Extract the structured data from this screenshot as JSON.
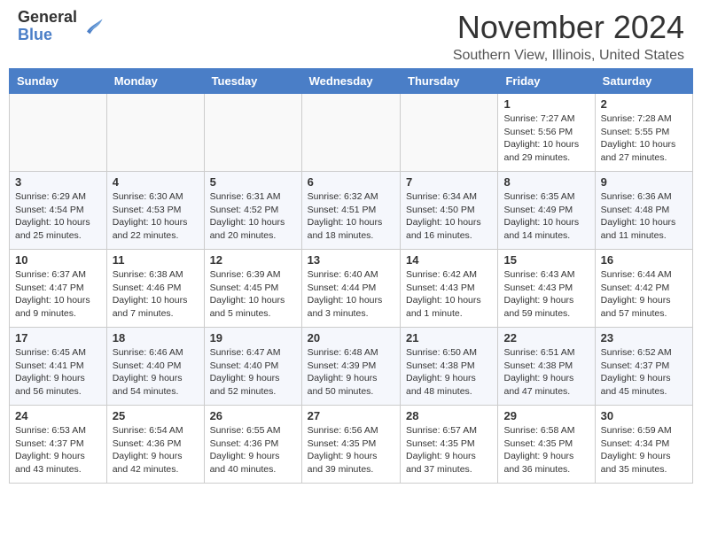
{
  "header": {
    "logo_general": "General",
    "logo_blue": "Blue",
    "month_title": "November 2024",
    "location": "Southern View, Illinois, United States"
  },
  "weekdays": [
    "Sunday",
    "Monday",
    "Tuesday",
    "Wednesday",
    "Thursday",
    "Friday",
    "Saturday"
  ],
  "weeks": [
    [
      {
        "day": "",
        "empty": true
      },
      {
        "day": "",
        "empty": true
      },
      {
        "day": "",
        "empty": true
      },
      {
        "day": "",
        "empty": true
      },
      {
        "day": "",
        "empty": true
      },
      {
        "day": "1",
        "sunrise": "Sunrise: 7:27 AM",
        "sunset": "Sunset: 5:56 PM",
        "daylight": "Daylight: 10 hours and 29 minutes."
      },
      {
        "day": "2",
        "sunrise": "Sunrise: 7:28 AM",
        "sunset": "Sunset: 5:55 PM",
        "daylight": "Daylight: 10 hours and 27 minutes."
      }
    ],
    [
      {
        "day": "3",
        "sunrise": "Sunrise: 6:29 AM",
        "sunset": "Sunset: 4:54 PM",
        "daylight": "Daylight: 10 hours and 25 minutes."
      },
      {
        "day": "4",
        "sunrise": "Sunrise: 6:30 AM",
        "sunset": "Sunset: 4:53 PM",
        "daylight": "Daylight: 10 hours and 22 minutes."
      },
      {
        "day": "5",
        "sunrise": "Sunrise: 6:31 AM",
        "sunset": "Sunset: 4:52 PM",
        "daylight": "Daylight: 10 hours and 20 minutes."
      },
      {
        "day": "6",
        "sunrise": "Sunrise: 6:32 AM",
        "sunset": "Sunset: 4:51 PM",
        "daylight": "Daylight: 10 hours and 18 minutes."
      },
      {
        "day": "7",
        "sunrise": "Sunrise: 6:34 AM",
        "sunset": "Sunset: 4:50 PM",
        "daylight": "Daylight: 10 hours and 16 minutes."
      },
      {
        "day": "8",
        "sunrise": "Sunrise: 6:35 AM",
        "sunset": "Sunset: 4:49 PM",
        "daylight": "Daylight: 10 hours and 14 minutes."
      },
      {
        "day": "9",
        "sunrise": "Sunrise: 6:36 AM",
        "sunset": "Sunset: 4:48 PM",
        "daylight": "Daylight: 10 hours and 11 minutes."
      }
    ],
    [
      {
        "day": "10",
        "sunrise": "Sunrise: 6:37 AM",
        "sunset": "Sunset: 4:47 PM",
        "daylight": "Daylight: 10 hours and 9 minutes."
      },
      {
        "day": "11",
        "sunrise": "Sunrise: 6:38 AM",
        "sunset": "Sunset: 4:46 PM",
        "daylight": "Daylight: 10 hours and 7 minutes."
      },
      {
        "day": "12",
        "sunrise": "Sunrise: 6:39 AM",
        "sunset": "Sunset: 4:45 PM",
        "daylight": "Daylight: 10 hours and 5 minutes."
      },
      {
        "day": "13",
        "sunrise": "Sunrise: 6:40 AM",
        "sunset": "Sunset: 4:44 PM",
        "daylight": "Daylight: 10 hours and 3 minutes."
      },
      {
        "day": "14",
        "sunrise": "Sunrise: 6:42 AM",
        "sunset": "Sunset: 4:43 PM",
        "daylight": "Daylight: 10 hours and 1 minute."
      },
      {
        "day": "15",
        "sunrise": "Sunrise: 6:43 AM",
        "sunset": "Sunset: 4:43 PM",
        "daylight": "Daylight: 9 hours and 59 minutes."
      },
      {
        "day": "16",
        "sunrise": "Sunrise: 6:44 AM",
        "sunset": "Sunset: 4:42 PM",
        "daylight": "Daylight: 9 hours and 57 minutes."
      }
    ],
    [
      {
        "day": "17",
        "sunrise": "Sunrise: 6:45 AM",
        "sunset": "Sunset: 4:41 PM",
        "daylight": "Daylight: 9 hours and 56 minutes."
      },
      {
        "day": "18",
        "sunrise": "Sunrise: 6:46 AM",
        "sunset": "Sunset: 4:40 PM",
        "daylight": "Daylight: 9 hours and 54 minutes."
      },
      {
        "day": "19",
        "sunrise": "Sunrise: 6:47 AM",
        "sunset": "Sunset: 4:40 PM",
        "daylight": "Daylight: 9 hours and 52 minutes."
      },
      {
        "day": "20",
        "sunrise": "Sunrise: 6:48 AM",
        "sunset": "Sunset: 4:39 PM",
        "daylight": "Daylight: 9 hours and 50 minutes."
      },
      {
        "day": "21",
        "sunrise": "Sunrise: 6:50 AM",
        "sunset": "Sunset: 4:38 PM",
        "daylight": "Daylight: 9 hours and 48 minutes."
      },
      {
        "day": "22",
        "sunrise": "Sunrise: 6:51 AM",
        "sunset": "Sunset: 4:38 PM",
        "daylight": "Daylight: 9 hours and 47 minutes."
      },
      {
        "day": "23",
        "sunrise": "Sunrise: 6:52 AM",
        "sunset": "Sunset: 4:37 PM",
        "daylight": "Daylight: 9 hours and 45 minutes."
      }
    ],
    [
      {
        "day": "24",
        "sunrise": "Sunrise: 6:53 AM",
        "sunset": "Sunset: 4:37 PM",
        "daylight": "Daylight: 9 hours and 43 minutes."
      },
      {
        "day": "25",
        "sunrise": "Sunrise: 6:54 AM",
        "sunset": "Sunset: 4:36 PM",
        "daylight": "Daylight: 9 hours and 42 minutes."
      },
      {
        "day": "26",
        "sunrise": "Sunrise: 6:55 AM",
        "sunset": "Sunset: 4:36 PM",
        "daylight": "Daylight: 9 hours and 40 minutes."
      },
      {
        "day": "27",
        "sunrise": "Sunrise: 6:56 AM",
        "sunset": "Sunset: 4:35 PM",
        "daylight": "Daylight: 9 hours and 39 minutes."
      },
      {
        "day": "28",
        "sunrise": "Sunrise: 6:57 AM",
        "sunset": "Sunset: 4:35 PM",
        "daylight": "Daylight: 9 hours and 37 minutes."
      },
      {
        "day": "29",
        "sunrise": "Sunrise: 6:58 AM",
        "sunset": "Sunset: 4:35 PM",
        "daylight": "Daylight: 9 hours and 36 minutes."
      },
      {
        "day": "30",
        "sunrise": "Sunrise: 6:59 AM",
        "sunset": "Sunset: 4:34 PM",
        "daylight": "Daylight: 9 hours and 35 minutes."
      }
    ]
  ]
}
